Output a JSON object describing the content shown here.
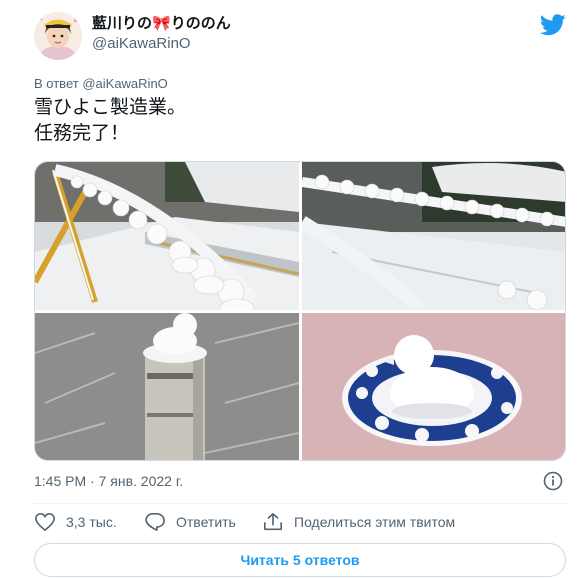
{
  "tweet": {
    "display_name": "藍川りの",
    "display_name_suffix": "りののん",
    "handle": "@aiKawaRinO",
    "reply_prefix": "В ответ",
    "reply_mention": "@aiKawaRinO",
    "text_line1": "雪ひよこ製造業。",
    "text_line2": "任務完了！",
    "timestamp": "1:45 PM · 7 янв. 2022 г.",
    "like_count": "3,3 тыс.",
    "reply_label": "Ответить",
    "share_label": "Поделиться этим твитом",
    "read_replies_label": "Читать 5 ответов"
  },
  "icons": {
    "brand": "twitter-bird-icon",
    "info": "info-icon",
    "like": "heart-icon",
    "reply": "speech-bubble-icon",
    "share": "share-icon",
    "bow": "red-ribbon-emoji"
  },
  "colors": {
    "accent": "#1d9bf0",
    "text": "#0f1419",
    "secondary": "#536471",
    "border": "#cfd9de"
  }
}
